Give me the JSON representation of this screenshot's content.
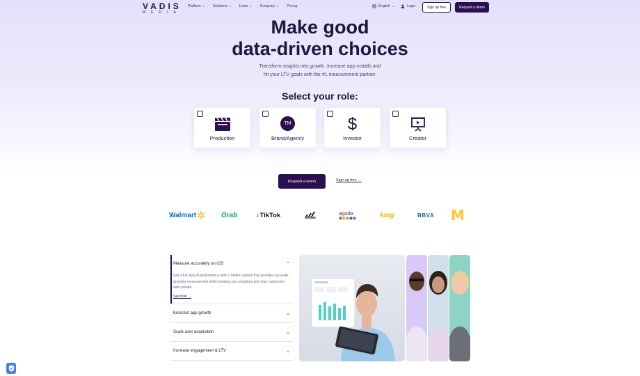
{
  "header": {
    "logo_word": "VADIS",
    "logo_sub": "MEDIA",
    "nav": [
      {
        "label": "Platform",
        "has_dropdown": true
      },
      {
        "label": "Solutions",
        "has_dropdown": true
      },
      {
        "label": "Learn",
        "has_dropdown": true
      },
      {
        "label": "Company",
        "has_dropdown": true
      },
      {
        "label": "Pricing",
        "has_dropdown": false
      }
    ],
    "language": "English",
    "login": "Login",
    "signup": "Sign up free",
    "request_demo": "Request a demo"
  },
  "hero": {
    "title_line1": "Make good",
    "title_line2": "data-driven choices",
    "subtitle_line1": "Transform insights into growth. Increase app installs and",
    "subtitle_line2": "hit your LTV goals with the #1 measurement partner.",
    "role_prompt": "Select your role:",
    "roles": [
      {
        "label": "Production",
        "icon": "clapperboard-icon",
        "checked": false
      },
      {
        "label": "Brand/Agency",
        "icon": "trademark-icon",
        "icon_text": "TM",
        "checked": false
      },
      {
        "label": "Investor",
        "icon": "dollar-icon",
        "icon_text": "$",
        "checked": false
      },
      {
        "label": "Creator",
        "icon": "presentation-play-icon",
        "checked": false
      }
    ],
    "cta_demo": "Request a demo",
    "cta_signup": "Sign up free →"
  },
  "brands": {
    "walmart": "Walmart",
    "grab": "Grab",
    "tiktok": "TikTok",
    "adidas": "adidas",
    "agoda": "agoda",
    "king": "king",
    "bbva": "BBVA",
    "mcdonalds": "M"
  },
  "accordion": [
    {
      "title": "Measure accurately on iOS",
      "expanded": true,
      "body": "Get a full view of performance with a SKAN solution that provides accurate, granular measurement while keeping you compliant and your customers' data private.",
      "link": "See how →"
    },
    {
      "title": "Kickstart app growth",
      "expanded": false
    },
    {
      "title": "Scale user acquisition",
      "expanded": false
    },
    {
      "title": "Increase engagement & LTV",
      "expanded": false
    }
  ],
  "colors": {
    "brand_dark": "#2b1050",
    "hero_bg": "#e4e0fb",
    "walmart_blue": "#0071ce",
    "walmart_spark": "#ffc220",
    "grab_green": "#00b14f",
    "mcd_yellow": "#ffc72c",
    "bbva_blue": "#1464a5"
  }
}
